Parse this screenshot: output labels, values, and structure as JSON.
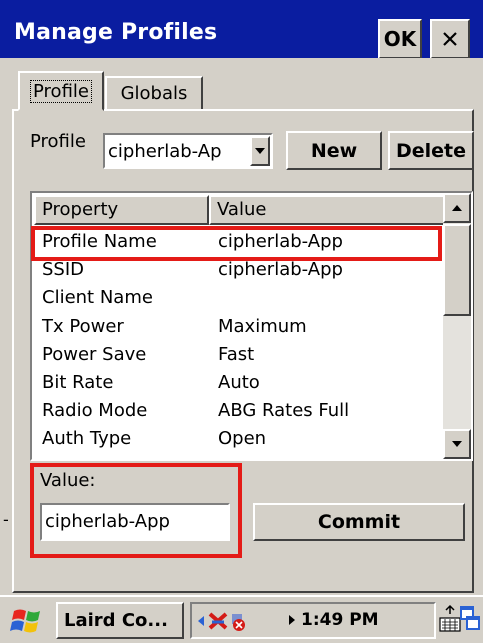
{
  "window": {
    "title": "Manage Profiles",
    "ok_label": "OK"
  },
  "tabs": [
    {
      "label": "Profile",
      "active": true
    },
    {
      "label": "Globals",
      "active": false
    }
  ],
  "profile_selector": {
    "label": "Profile",
    "selected": "cipherlab-Ap",
    "new_label": "New",
    "delete_label": "Delete"
  },
  "table": {
    "columns": [
      "Property",
      "Value"
    ],
    "rows": [
      {
        "property": "Profile Name",
        "value": "cipherlab-App",
        "highlighted": true
      },
      {
        "property": "SSID",
        "value": "cipherlab-App"
      },
      {
        "property": "Client Name",
        "value": ""
      },
      {
        "property": "Tx Power",
        "value": "Maximum"
      },
      {
        "property": "Power Save",
        "value": "Fast"
      },
      {
        "property": "Bit Rate",
        "value": "Auto"
      },
      {
        "property": "Radio Mode",
        "value": "ABG Rates Full"
      },
      {
        "property": "Auth Type",
        "value": "Open"
      }
    ]
  },
  "value_editor": {
    "label": "Value:",
    "value": "cipherlab-App",
    "commit_label": "Commit",
    "dash": "-"
  },
  "taskbar": {
    "task_label": "Laird Co...",
    "clock": "1:49 PM"
  },
  "colors": {
    "titlebar": "#0a1da0",
    "face": "#d4d0c8",
    "highlight_box": "#e41b17"
  }
}
